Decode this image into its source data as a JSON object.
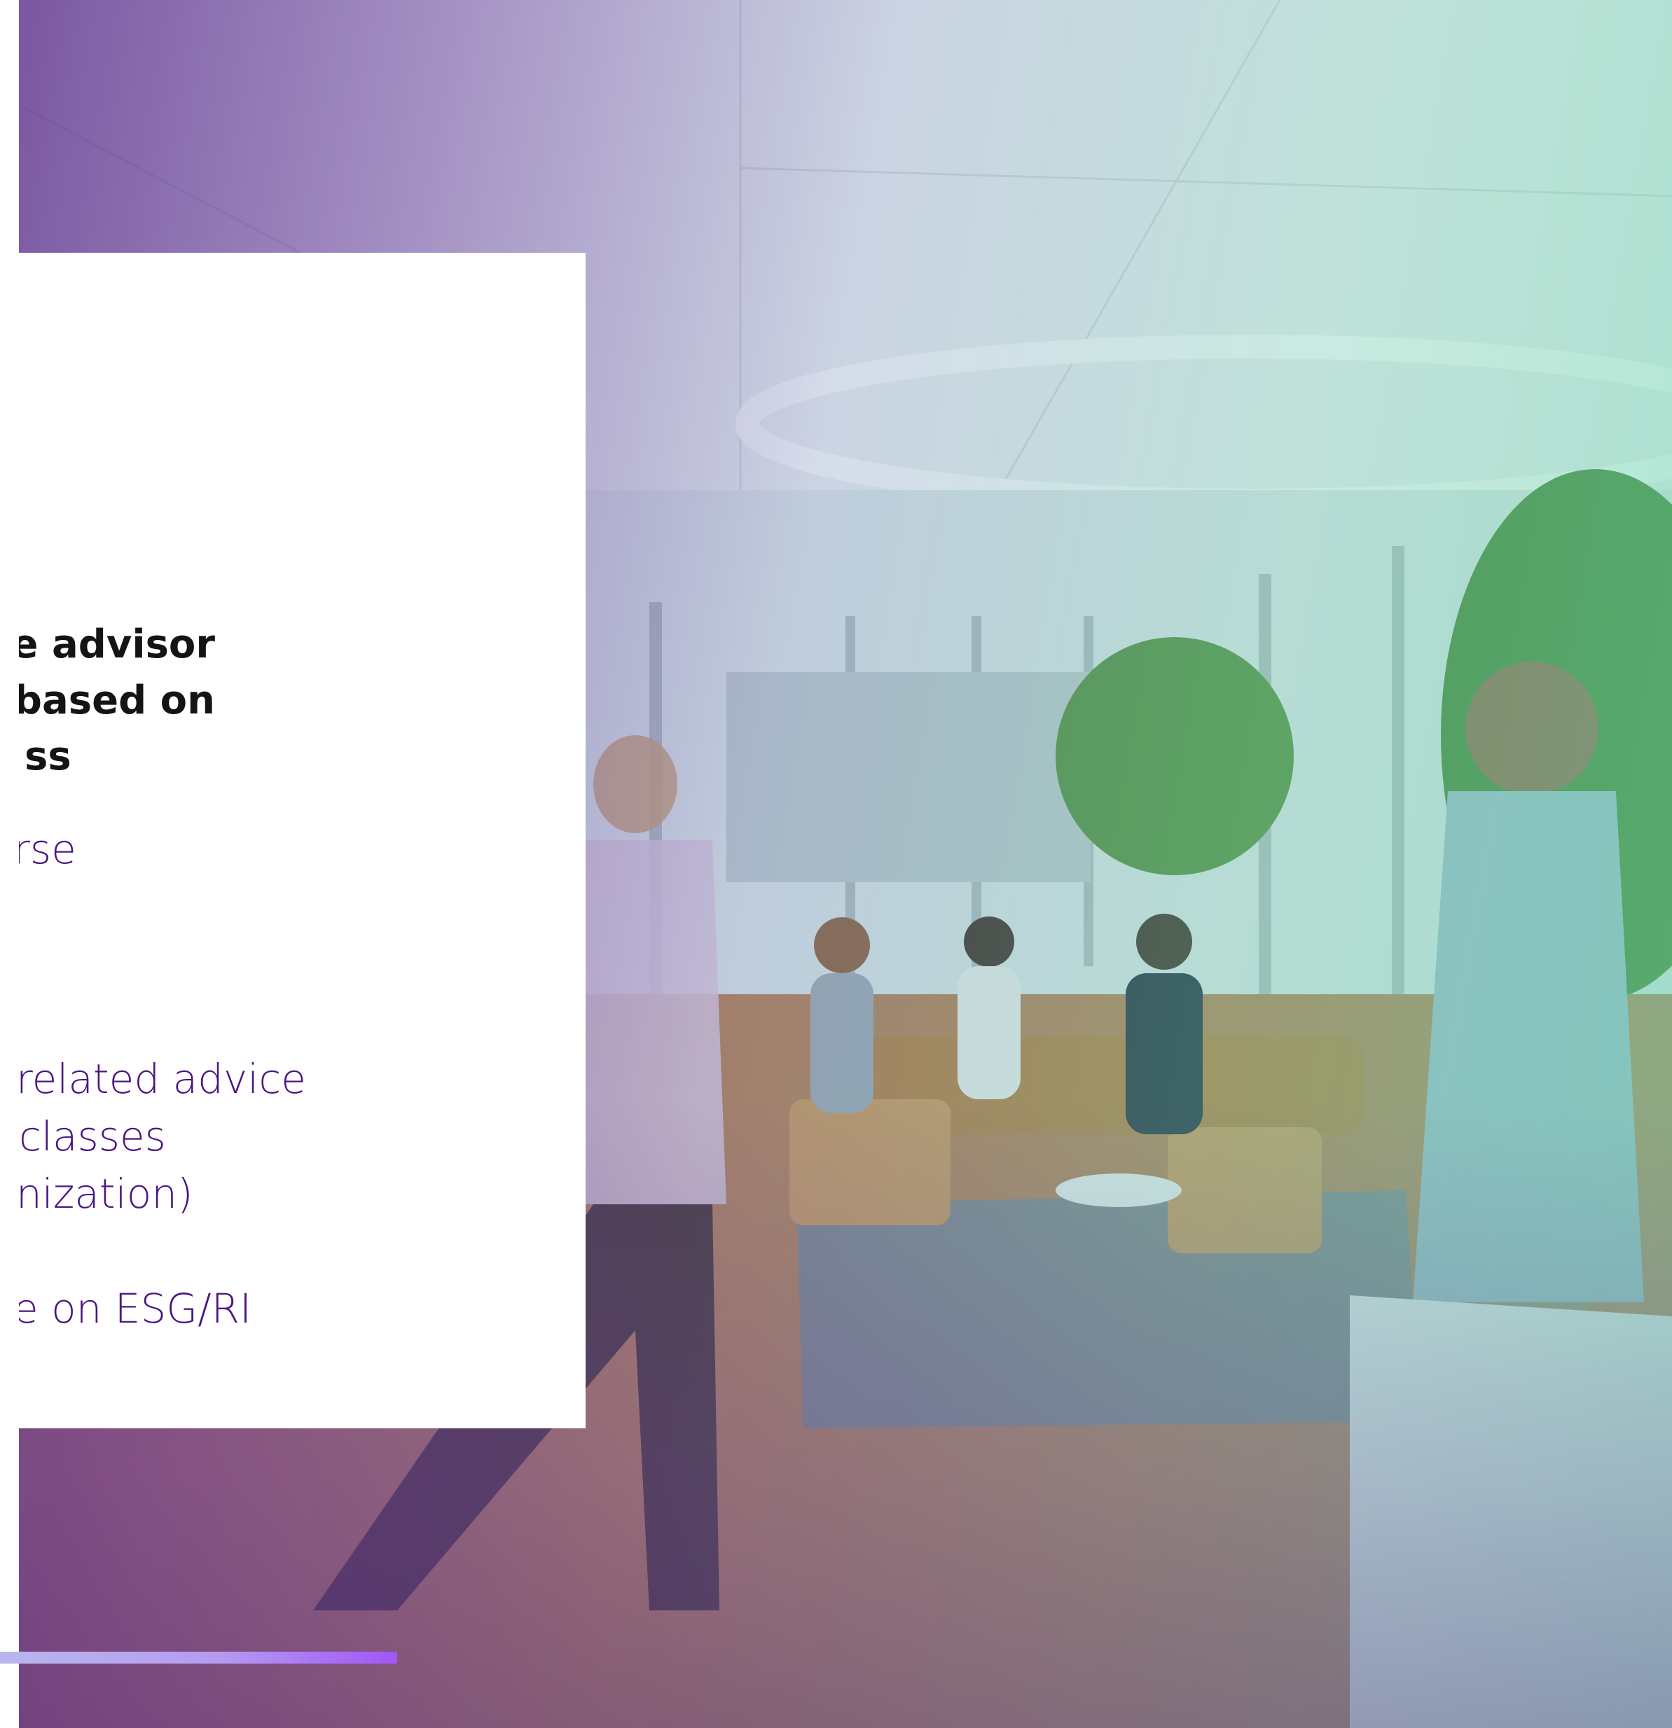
{
  "card": {
    "heading_lines": [
      "e advisor",
      "based on",
      "ss"
    ],
    "body_lines": [
      "rse",
      "related advice",
      " classes",
      "nization)",
      "e on ESG/RI"
    ]
  },
  "colors": {
    "heading": "#141414",
    "body_text": "#4b1782",
    "accent_bar_start": "#b9b7ee",
    "accent_bar_end": "#a255f7",
    "tint_purple": "#5c2e8c",
    "tint_green": "#6ed7af"
  }
}
